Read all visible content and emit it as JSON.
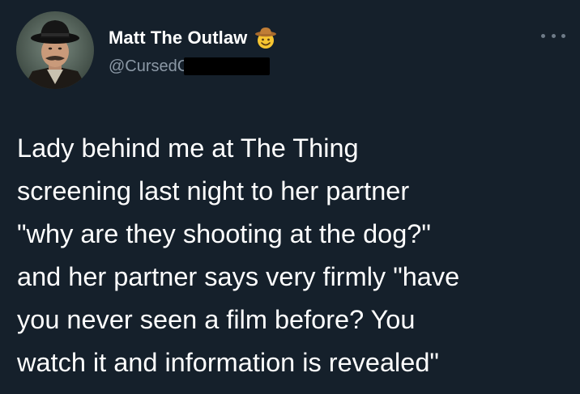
{
  "author": {
    "display_name": "Matt The Outlaw",
    "handle": "@CursedC",
    "badge_emoji": "cowboy-hat-face-icon"
  },
  "menu": {
    "more_icon": "more-horizontal-icon"
  },
  "tweet": {
    "lines": [
      "Lady behind me at The Thing",
      "screening last night to her partner",
      "\"why are they shooting at the dog?\"",
      "and her partner says very firmly \"have",
      "you never seen a film before? You",
      "watch it and information is revealed\""
    ]
  },
  "colors": {
    "background": "#15202b",
    "text_primary": "#ffffff",
    "text_secondary": "#8b98a5",
    "redaction": "#000000"
  }
}
